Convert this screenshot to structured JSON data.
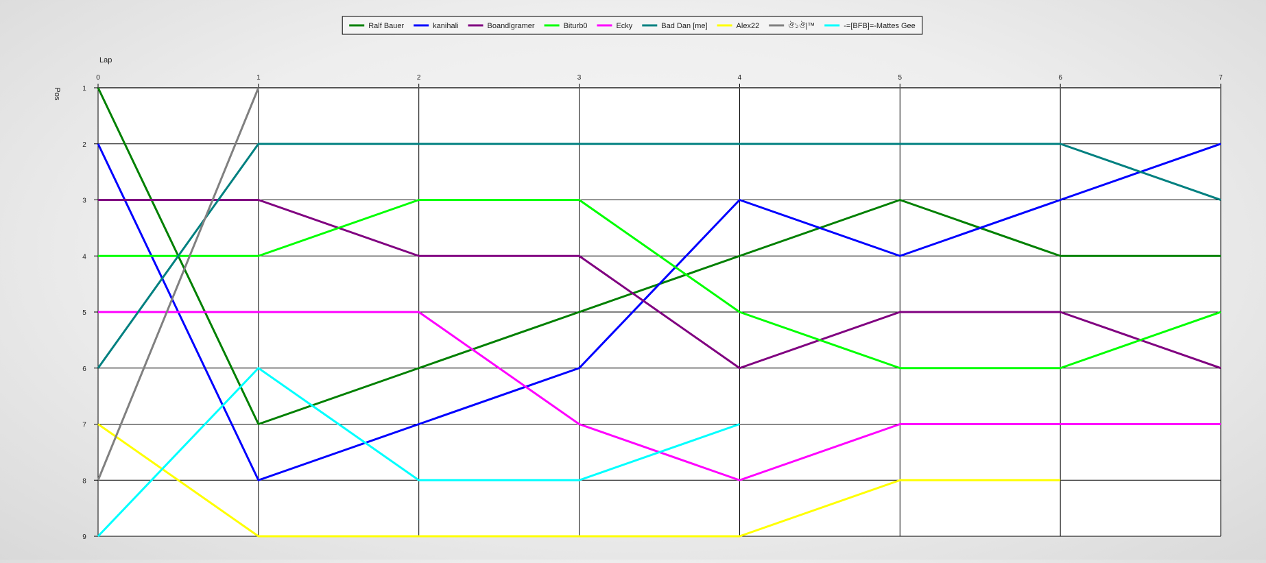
{
  "chart_data": {
    "type": "line",
    "xlabel": "Lap",
    "ylabel": "Pos",
    "x": [
      0,
      1,
      2,
      3,
      4,
      5,
      6,
      7
    ],
    "xlim": [
      0,
      7
    ],
    "ylim": [
      1,
      9
    ],
    "y_inverted": true,
    "x_ticks": [
      "0",
      "1",
      "2",
      "3",
      "4",
      "5",
      "6",
      "7"
    ],
    "y_ticks": [
      "1",
      "2",
      "3",
      "4",
      "5",
      "6",
      "7",
      "8",
      "9"
    ],
    "grid": true,
    "legend_position": "top-center",
    "series": [
      {
        "name": "Ralf Bauer",
        "color": "#008000",
        "values": [
          1,
          7,
          6,
          5,
          4,
          3,
          4,
          4
        ]
      },
      {
        "name": "kanihali",
        "color": "#0000ff",
        "values": [
          2,
          8,
          7,
          6,
          3,
          4,
          3,
          2
        ]
      },
      {
        "name": "Boandlgramer",
        "color": "#800080",
        "values": [
          3,
          3,
          4,
          4,
          6,
          5,
          5,
          6
        ]
      },
      {
        "name": "Biturb0",
        "color": "#00ff00",
        "values": [
          4,
          4,
          3,
          3,
          5,
          6,
          6,
          5
        ]
      },
      {
        "name": "Ecky",
        "color": "#ff00ff",
        "values": [
          5,
          5,
          5,
          7,
          8,
          7,
          7,
          7
        ]
      },
      {
        "name": "Bad Dan [me]",
        "color": "#008080",
        "values": [
          6,
          2,
          2,
          2,
          2,
          2,
          2,
          3
        ]
      },
      {
        "name": "Alex22",
        "color": "#ffff00",
        "values": [
          7,
          9,
          9,
          9,
          9,
          8,
          8,
          null
        ]
      },
      {
        "name": "ঔ১ঔ|™",
        "color": "#808080",
        "values": [
          8,
          1,
          null,
          null,
          null,
          null,
          null,
          null
        ]
      },
      {
        "name": "-=[BFB]=-Mattes Gee",
        "color": "#00ffff",
        "values": [
          9,
          6,
          8,
          8,
          7,
          null,
          null,
          null
        ]
      }
    ]
  }
}
